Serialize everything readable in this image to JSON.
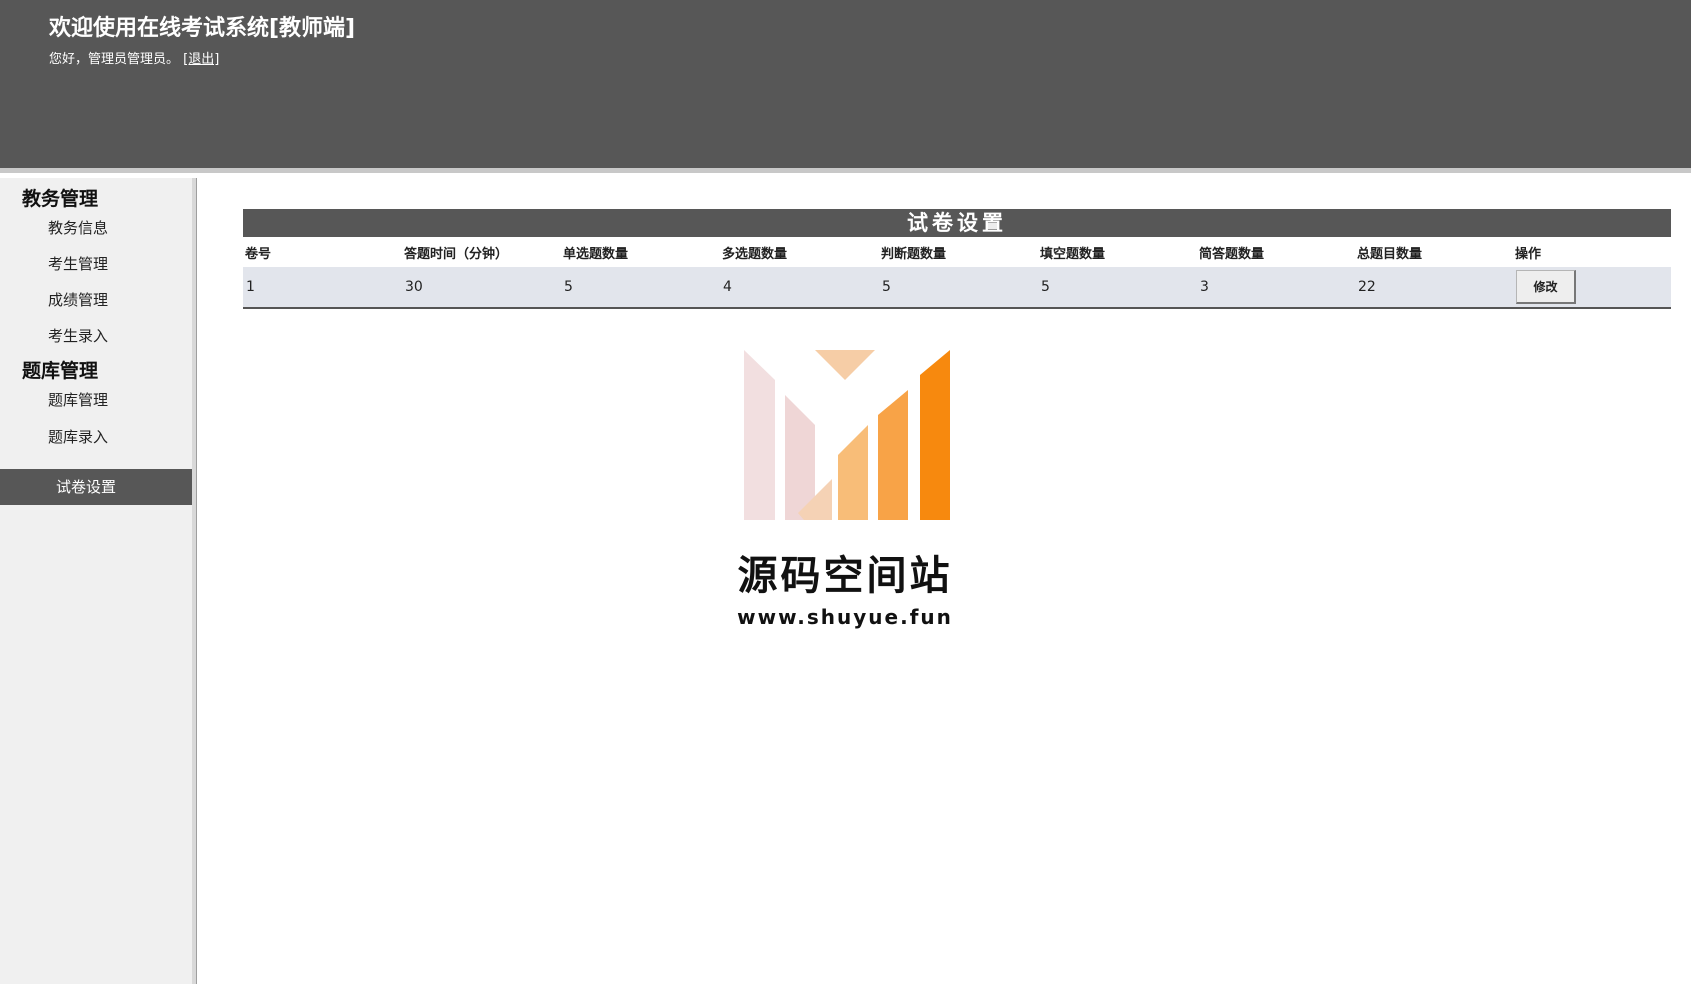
{
  "header": {
    "title": "欢迎使用在线考试系统[教师端]",
    "greeting": "您好，管理员管理员。",
    "logout_label": "[退出]"
  },
  "sidebar": {
    "groups": [
      {
        "title": "教务管理",
        "items": [
          {
            "label": "教务信息"
          },
          {
            "label": "考生管理"
          },
          {
            "label": "成绩管理"
          },
          {
            "label": "考生录入"
          }
        ]
      },
      {
        "title": "题库管理",
        "items": [
          {
            "label": "题库管理"
          },
          {
            "label": "题库录入"
          },
          {
            "label": "试卷设置",
            "active": true
          }
        ]
      }
    ]
  },
  "main": {
    "panel_title": "试卷设置",
    "columns": [
      "卷号",
      "答题时间（分钟）",
      "单选题数量",
      "多选题数量",
      "判断题数量",
      "填空题数量",
      "简答题数量",
      "总题目数量",
      "操作"
    ],
    "rows": [
      {
        "cells": [
          "1",
          "30",
          "5",
          "4",
          "5",
          "5",
          "3",
          "22"
        ],
        "action_label": "修改"
      }
    ]
  },
  "watermark": {
    "name": "源码空间站",
    "url": "www.shuyue.fun"
  },
  "colors": {
    "header_bg": "#575757",
    "sidebar_bg": "#f0f0f0",
    "active_bg": "#575757",
    "row_bg": "#e2e5ec",
    "logo_orange": "#f7890e"
  }
}
